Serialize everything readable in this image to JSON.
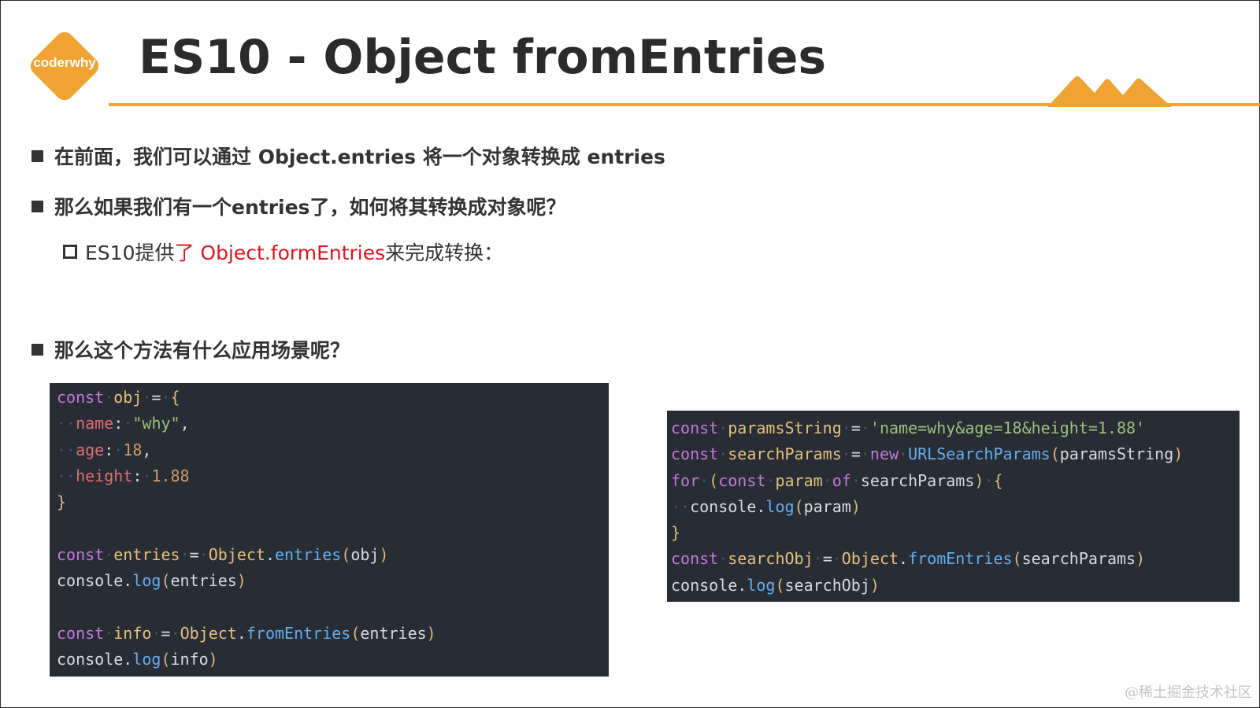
{
  "logo": {
    "text": "coderwhy",
    "color": "#f0a233"
  },
  "title": "ES10 - Object fromEntries",
  "accent_color": "#f0a233",
  "bullets": [
    "在前面，我们可以通过 Object.entries 将一个对象转换成 entries",
    "那么如果我们有一个entries了，如何将其转换成对象呢？",
    "那么这个方法有什么应用场景呢？"
  ],
  "sub_bullet": {
    "prefix": "ES10提供",
    "highlight": "了 Object.formEntries",
    "suffix": "来完成转换："
  },
  "code_left": [
    [
      [
        "kw",
        "const"
      ],
      [
        "ws",
        "·"
      ],
      [
        "var",
        "obj"
      ],
      [
        "ws",
        "·"
      ],
      [
        "pl",
        "="
      ],
      [
        "ws",
        "·"
      ],
      [
        "br",
        "{"
      ]
    ],
    [
      [
        "ws",
        "··"
      ],
      [
        "prop",
        "name"
      ],
      [
        "pl",
        ":"
      ],
      [
        "ws",
        "·"
      ],
      [
        "str",
        "\"why\""
      ],
      [
        "pl",
        ","
      ]
    ],
    [
      [
        "ws",
        "··"
      ],
      [
        "prop",
        "age"
      ],
      [
        "pl",
        ":"
      ],
      [
        "ws",
        "·"
      ],
      [
        "num",
        "18"
      ],
      [
        "pl",
        ","
      ]
    ],
    [
      [
        "ws",
        "··"
      ],
      [
        "prop",
        "height"
      ],
      [
        "pl",
        ":"
      ],
      [
        "ws",
        "·"
      ],
      [
        "num",
        "1.88"
      ]
    ],
    [
      [
        "br",
        "}"
      ]
    ],
    [],
    [
      [
        "kw",
        "const"
      ],
      [
        "ws",
        "·"
      ],
      [
        "var",
        "entries"
      ],
      [
        "ws",
        "·"
      ],
      [
        "pl",
        "="
      ],
      [
        "ws",
        "·"
      ],
      [
        "var",
        "Object"
      ],
      [
        "pl",
        "."
      ],
      [
        "fn",
        "entries"
      ],
      [
        "br",
        "("
      ],
      [
        "pl",
        "obj"
      ],
      [
        "br",
        ")"
      ]
    ],
    [
      [
        "pl",
        "console."
      ],
      [
        "fn",
        "log"
      ],
      [
        "br",
        "("
      ],
      [
        "pl",
        "entries"
      ],
      [
        "br",
        ")"
      ]
    ],
    [],
    [
      [
        "kw",
        "const"
      ],
      [
        "ws",
        "·"
      ],
      [
        "var",
        "info"
      ],
      [
        "ws",
        "·"
      ],
      [
        "pl",
        "="
      ],
      [
        "ws",
        "·"
      ],
      [
        "var",
        "Object"
      ],
      [
        "pl",
        "."
      ],
      [
        "fn",
        "fromEntries"
      ],
      [
        "br",
        "("
      ],
      [
        "pl",
        "entries"
      ],
      [
        "br",
        ")"
      ]
    ],
    [
      [
        "pl",
        "console."
      ],
      [
        "fn",
        "log"
      ],
      [
        "br",
        "("
      ],
      [
        "pl",
        "info"
      ],
      [
        "br",
        ")"
      ]
    ]
  ],
  "code_right": [
    [
      [
        "kw",
        "const"
      ],
      [
        "ws",
        "·"
      ],
      [
        "var",
        "paramsString"
      ],
      [
        "ws",
        "·"
      ],
      [
        "pl",
        "="
      ],
      [
        "ws",
        "·"
      ],
      [
        "str",
        "'name=why&age=18&height=1.88'"
      ]
    ],
    [
      [
        "kw",
        "const"
      ],
      [
        "ws",
        "·"
      ],
      [
        "var",
        "searchParams"
      ],
      [
        "ws",
        "·"
      ],
      [
        "pl",
        "="
      ],
      [
        "ws",
        "·"
      ],
      [
        "kw",
        "new"
      ],
      [
        "ws",
        "·"
      ],
      [
        "fn",
        "URLSearchParams"
      ],
      [
        "br",
        "("
      ],
      [
        "pl",
        "paramsString"
      ],
      [
        "br",
        ")"
      ]
    ],
    [
      [
        "kw",
        "for"
      ],
      [
        "ws",
        "·"
      ],
      [
        "br",
        "("
      ],
      [
        "kw",
        "const"
      ],
      [
        "ws",
        "·"
      ],
      [
        "var",
        "param"
      ],
      [
        "ws",
        "·"
      ],
      [
        "kw",
        "of"
      ],
      [
        "ws",
        "·"
      ],
      [
        "pl",
        "searchParams"
      ],
      [
        "br",
        ")"
      ],
      [
        "ws",
        "·"
      ],
      [
        "br",
        "{"
      ]
    ],
    [
      [
        "ws",
        "··"
      ],
      [
        "pl",
        "console."
      ],
      [
        "fn",
        "log"
      ],
      [
        "br",
        "("
      ],
      [
        "pl",
        "param"
      ],
      [
        "br",
        ")"
      ]
    ],
    [
      [
        "br",
        "}"
      ]
    ],
    [
      [
        "kw",
        "const"
      ],
      [
        "ws",
        "·"
      ],
      [
        "var",
        "searchObj"
      ],
      [
        "ws",
        "·"
      ],
      [
        "pl",
        "="
      ],
      [
        "ws",
        "·"
      ],
      [
        "var",
        "Object"
      ],
      [
        "pl",
        "."
      ],
      [
        "fn",
        "fromEntries"
      ],
      [
        "br",
        "("
      ],
      [
        "pl",
        "searchParams"
      ],
      [
        "br",
        ")"
      ]
    ],
    [
      [
        "pl",
        "console."
      ],
      [
        "fn",
        "log"
      ],
      [
        "br",
        "("
      ],
      [
        "pl",
        "searchObj"
      ],
      [
        "br",
        ")"
      ]
    ]
  ],
  "watermark": "@稀土掘金技术社区"
}
